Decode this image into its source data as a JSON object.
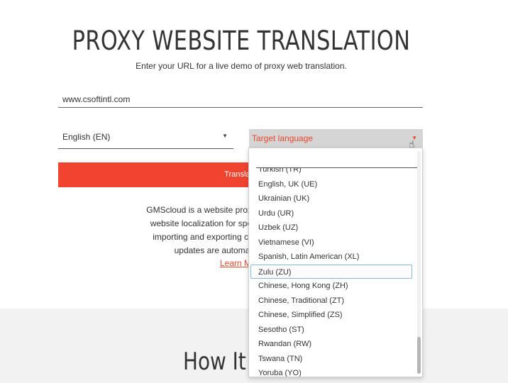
{
  "header": {
    "title": "PROXY WEBSITE TRANSLATION",
    "subtitle": "Enter your URL for a live demo of proxy web translation."
  },
  "form": {
    "url_value": "www.csoftintl.com",
    "source_language": "English (EN)",
    "target_language_placeholder": "Target language",
    "translate_button": "Translate"
  },
  "description": {
    "line1": "GMScloud is a website proxy translation cloud cre",
    "line2": "website localization for speed and agility. It elimi",
    "line3": "importing and exporting content for translation.",
    "line4": "updates are automatically captured",
    "learn_more": "Learn M"
  },
  "section": {
    "heading": "How It W"
  },
  "dropdown": {
    "options": [
      "Turkish (TR)",
      "English, UK (UE)",
      "Ukrainian (UK)",
      "Urdu (UR)",
      "Uzbek (UZ)",
      "Vietnamese (VI)",
      "Spanish, Latin American (XL)",
      "Zulu (ZU)",
      "Chinese, Hong Kong (ZH)",
      "Chinese, Traditional (ZT)",
      "Chinese, Simplified (ZS)",
      "Sesotho (ST)",
      "Rwandan (RW)",
      "Tswana (TN)",
      "Yoruba (YO)"
    ],
    "selected": "Zulu (ZU)"
  },
  "colors": {
    "accent": "#f04430",
    "link": "#e8472f",
    "band": "#f2f2f2"
  }
}
